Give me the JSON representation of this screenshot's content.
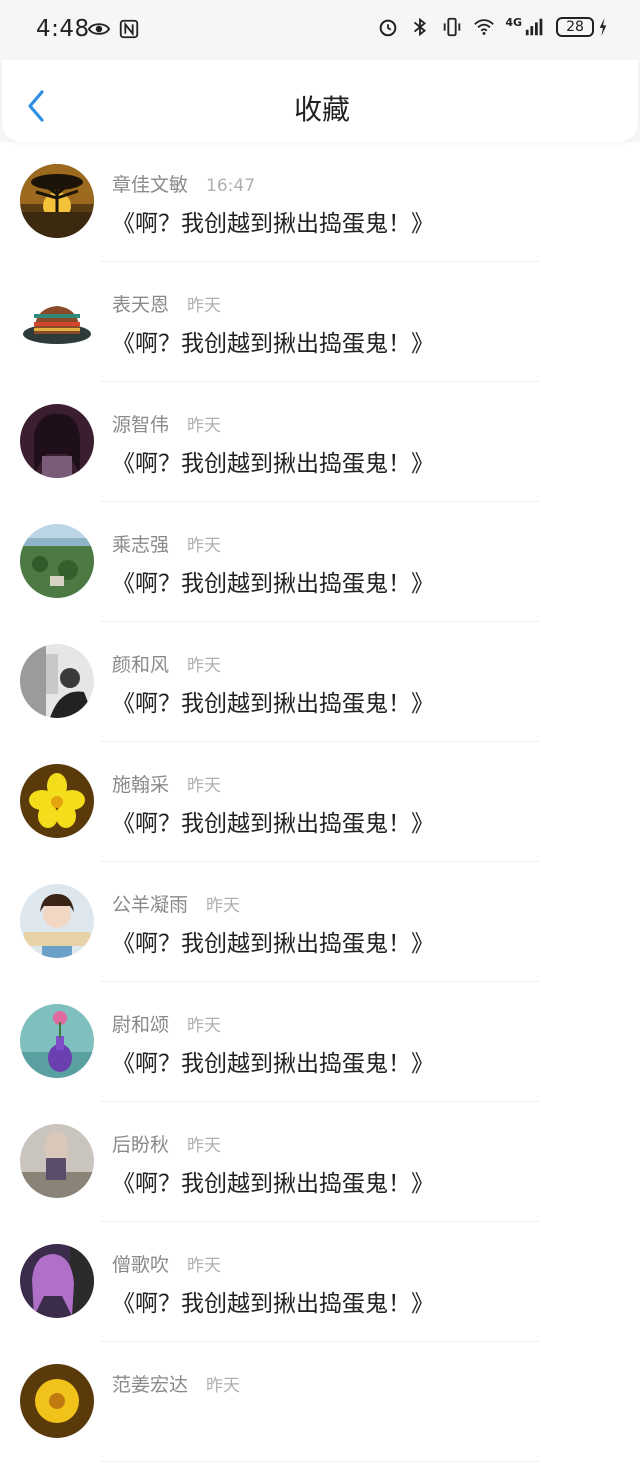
{
  "status_bar": {
    "time": "4:48",
    "battery": "28",
    "network": "4G",
    "icons": [
      "eye-icon",
      "nfc-icon",
      "alarm-icon",
      "bluetooth-icon",
      "vibrate-icon",
      "wifi-icon",
      "signal-icon",
      "charging-icon"
    ]
  },
  "header": {
    "title": "收藏",
    "back_icon": "chevron-left-icon"
  },
  "items": [
    {
      "name": "章佳文敏",
      "time": "16:47",
      "message": "《啊？我创越到揪出捣蛋鬼！》",
      "avatar_color": "#c58a2a"
    },
    {
      "name": "表天恩",
      "time": "昨天",
      "message": "《啊？我创越到揪出捣蛋鬼！》",
      "avatar_color": "#2f6a5f"
    },
    {
      "name": "源智伟",
      "time": "昨天",
      "message": "《啊？我创越到揪出捣蛋鬼！》",
      "avatar_color": "#6e3f57"
    },
    {
      "name": "乘志强",
      "time": "昨天",
      "message": "《啊？我创越到揪出捣蛋鬼！》",
      "avatar_color": "#5a7a4e"
    },
    {
      "name": "颜和风",
      "time": "昨天",
      "message": "《啊？我创越到揪出捣蛋鬼！》",
      "avatar_color": "#6b6b6b"
    },
    {
      "name": "施翰采",
      "time": "昨天",
      "message": "《啊？我创越到揪出捣蛋鬼！》",
      "avatar_color": "#e2c021"
    },
    {
      "name": "公羊凝雨",
      "time": "昨天",
      "message": "《啊？我创越到揪出捣蛋鬼！》",
      "avatar_color": "#8aa9c2"
    },
    {
      "name": "尉和颂",
      "time": "昨天",
      "message": "《啊？我创越到揪出捣蛋鬼！》",
      "avatar_color": "#6ca7a8"
    },
    {
      "name": "后盼秋",
      "time": "昨天",
      "message": "《啊？我创越到揪出捣蛋鬼！》",
      "avatar_color": "#a9a6a2"
    },
    {
      "name": "僧歌吹",
      "time": "昨天",
      "message": "《啊？我创越到揪出捣蛋鬼！》",
      "avatar_color": "#8c6aa5"
    },
    {
      "name": "范姜宏达",
      "time": "昨天",
      "message": "",
      "avatar_color": "#e5b21c"
    }
  ]
}
